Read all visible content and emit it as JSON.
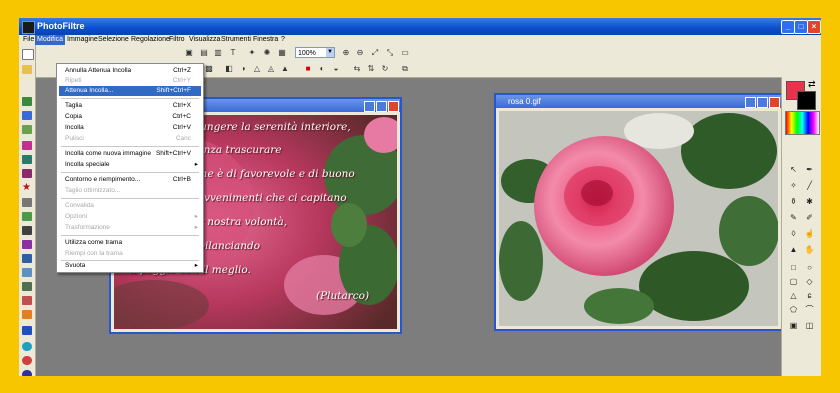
{
  "app": {
    "title": "PhotoFiltre"
  },
  "window_buttons": {
    "minimize": "_",
    "maximize": "□",
    "close": "×"
  },
  "menubar": [
    "File",
    "Modifica",
    "Immagine",
    "Selezione",
    "Regolazione",
    "Filtro",
    "Visualizza",
    "Strumenti",
    "Finestra",
    "?"
  ],
  "zoom": {
    "value": "100%"
  },
  "edit_menu": {
    "items": [
      {
        "label": "Annulla Attenua Incolla",
        "shortcut": "Ctrl+Z",
        "disabled": false
      },
      {
        "label": "Ripeti",
        "shortcut": "Ctrl+Y",
        "disabled": true
      },
      {
        "label": "Attenua Incolla...",
        "shortcut": "Shift+Ctrl+F",
        "disabled": false,
        "highlight": true
      },
      {
        "label": "Taglia",
        "shortcut": "Ctrl+X",
        "disabled": false
      },
      {
        "label": "Copia",
        "shortcut": "Ctrl+C",
        "disabled": false
      },
      {
        "label": "Incolla",
        "shortcut": "Ctrl+V",
        "disabled": false
      },
      {
        "label": "Pulisci",
        "shortcut": "Canc",
        "disabled": true
      },
      {
        "label": "Incolla come nuova immagine",
        "shortcut": "Shift+Ctrl+V",
        "disabled": false
      },
      {
        "label": "Incolla speciale",
        "shortcut": "▸",
        "disabled": false
      },
      {
        "label": "Contorno e riempimento...",
        "shortcut": "Ctrl+B",
        "disabled": false
      },
      {
        "label": "Taglio ottimizzato...",
        "shortcut": "",
        "disabled": true
      },
      {
        "label": "Convalida",
        "shortcut": "",
        "disabled": true
      },
      {
        "label": "Opzioni",
        "shortcut": "▸",
        "disabled": true
      },
      {
        "label": "Trasformazione",
        "shortcut": "▸",
        "disabled": true
      },
      {
        "label": "Utilizza come trama",
        "shortcut": "",
        "disabled": false
      },
      {
        "label": "Riempi con la trama",
        "shortcut": "",
        "disabled": true
      },
      {
        "label": "Svuota",
        "shortcut": "▸",
        "disabled": false
      }
    ]
  },
  "doc_left": {
    "poem": [
      "raggiungere la serenità interiore,",
      "senza trascurare",
      "ciò che è di favorevole e di buono",
      "negli avvenimenti che ci capitano",
      "per nostra volontà,",
      "oscurando e bilanciando",
      "il peggio con il meglio.",
      "(Plutarco)"
    ]
  },
  "doc_right": {
    "title": "rosa 0.gif"
  },
  "colors": {
    "foreground": "#e8334a",
    "background": "#000000",
    "titlebar": "#0a4fcf",
    "menu_highlight": "#316ac5"
  }
}
